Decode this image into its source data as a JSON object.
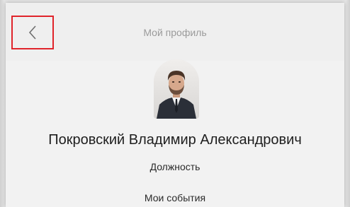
{
  "header": {
    "title": "Мой профиль",
    "back_icon": "chevron-left-icon",
    "highlight_color": "#e0242b"
  },
  "profile": {
    "avatar_icon": "profile-photo",
    "name": "Покровский Владимир Александрович",
    "position": "Должность"
  },
  "menu": {
    "events_label": "Мои события"
  }
}
